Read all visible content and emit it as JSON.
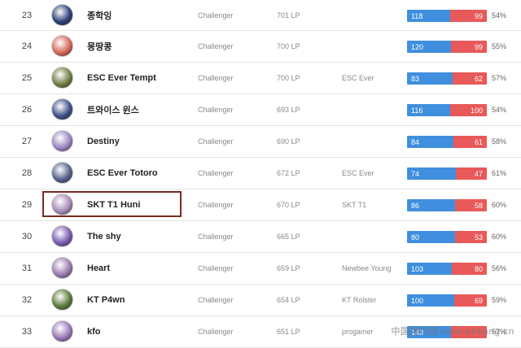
{
  "rows": [
    {
      "rank": "23",
      "name": "종학잉",
      "tier": "Challenger",
      "lp": "701 LP",
      "team": "",
      "wins": "118",
      "losses": "99",
      "pct": "54%",
      "avatar_color": "#2c3f78"
    },
    {
      "rank": "24",
      "name": "몽땅콩",
      "tier": "Challenger",
      "lp": "700 LP",
      "team": "",
      "wins": "120",
      "losses": "99",
      "pct": "55%",
      "avatar_color": "#d6685a"
    },
    {
      "rank": "25",
      "name": "ESC Ever Tempt",
      "tier": "Challenger",
      "lp": "700 LP",
      "team": "ESC Ever",
      "wins": "83",
      "losses": "62",
      "pct": "57%",
      "avatar_color": "#6f7f44"
    },
    {
      "rank": "26",
      "name": "트와이스 윈스",
      "tier": "Challenger",
      "lp": "693 LP",
      "team": "",
      "wins": "116",
      "losses": "100",
      "pct": "54%",
      "avatar_color": "#3d4f87"
    },
    {
      "rank": "27",
      "name": "Destiny",
      "tier": "Challenger",
      "lp": "690 LP",
      "team": "",
      "wins": "84",
      "losses": "61",
      "pct": "58%",
      "avatar_color": "#9b86c4"
    },
    {
      "rank": "28",
      "name": "ESC Ever Totoro",
      "tier": "Challenger",
      "lp": "672 LP",
      "team": "ESC Ever",
      "wins": "74",
      "losses": "47",
      "pct": "61%",
      "avatar_color": "#55608a"
    },
    {
      "rank": "29",
      "name": "SKT T1 Huni",
      "tier": "Challenger",
      "lp": "670 LP",
      "team": "SKT T1",
      "wins": "86",
      "losses": "58",
      "pct": "60%",
      "avatar_color": "#a88bb8",
      "highlighted": true
    },
    {
      "rank": "30",
      "name": "The shy",
      "tier": "Challenger",
      "lp": "665 LP",
      "team": "",
      "wins": "80",
      "losses": "53",
      "pct": "60%",
      "avatar_color": "#7a5cb0"
    },
    {
      "rank": "31",
      "name": "Heart",
      "tier": "Challenger",
      "lp": "659 LP",
      "team": "Newbee Young",
      "wins": "103",
      "losses": "80",
      "pct": "56%",
      "avatar_color": "#9c7bb0"
    },
    {
      "rank": "32",
      "name": "KT P4wn",
      "tier": "Challenger",
      "lp": "654 LP",
      "team": "KT Rolster",
      "wins": "100",
      "losses": "69",
      "pct": "59%",
      "avatar_color": "#5c7a3a"
    },
    {
      "rank": "33",
      "name": "kfo",
      "tier": "Challenger",
      "lp": "651 LP",
      "team": "progamer",
      "wins": "143",
      "losses": "",
      "pct": "57%",
      "avatar_color": "#9a78b8"
    }
  ],
  "watermark": "中国排行网 www.phbang.cn",
  "colors": {
    "wins": "#3f8fde",
    "losses": "#e85959",
    "highlight": "#7a2a1e"
  }
}
